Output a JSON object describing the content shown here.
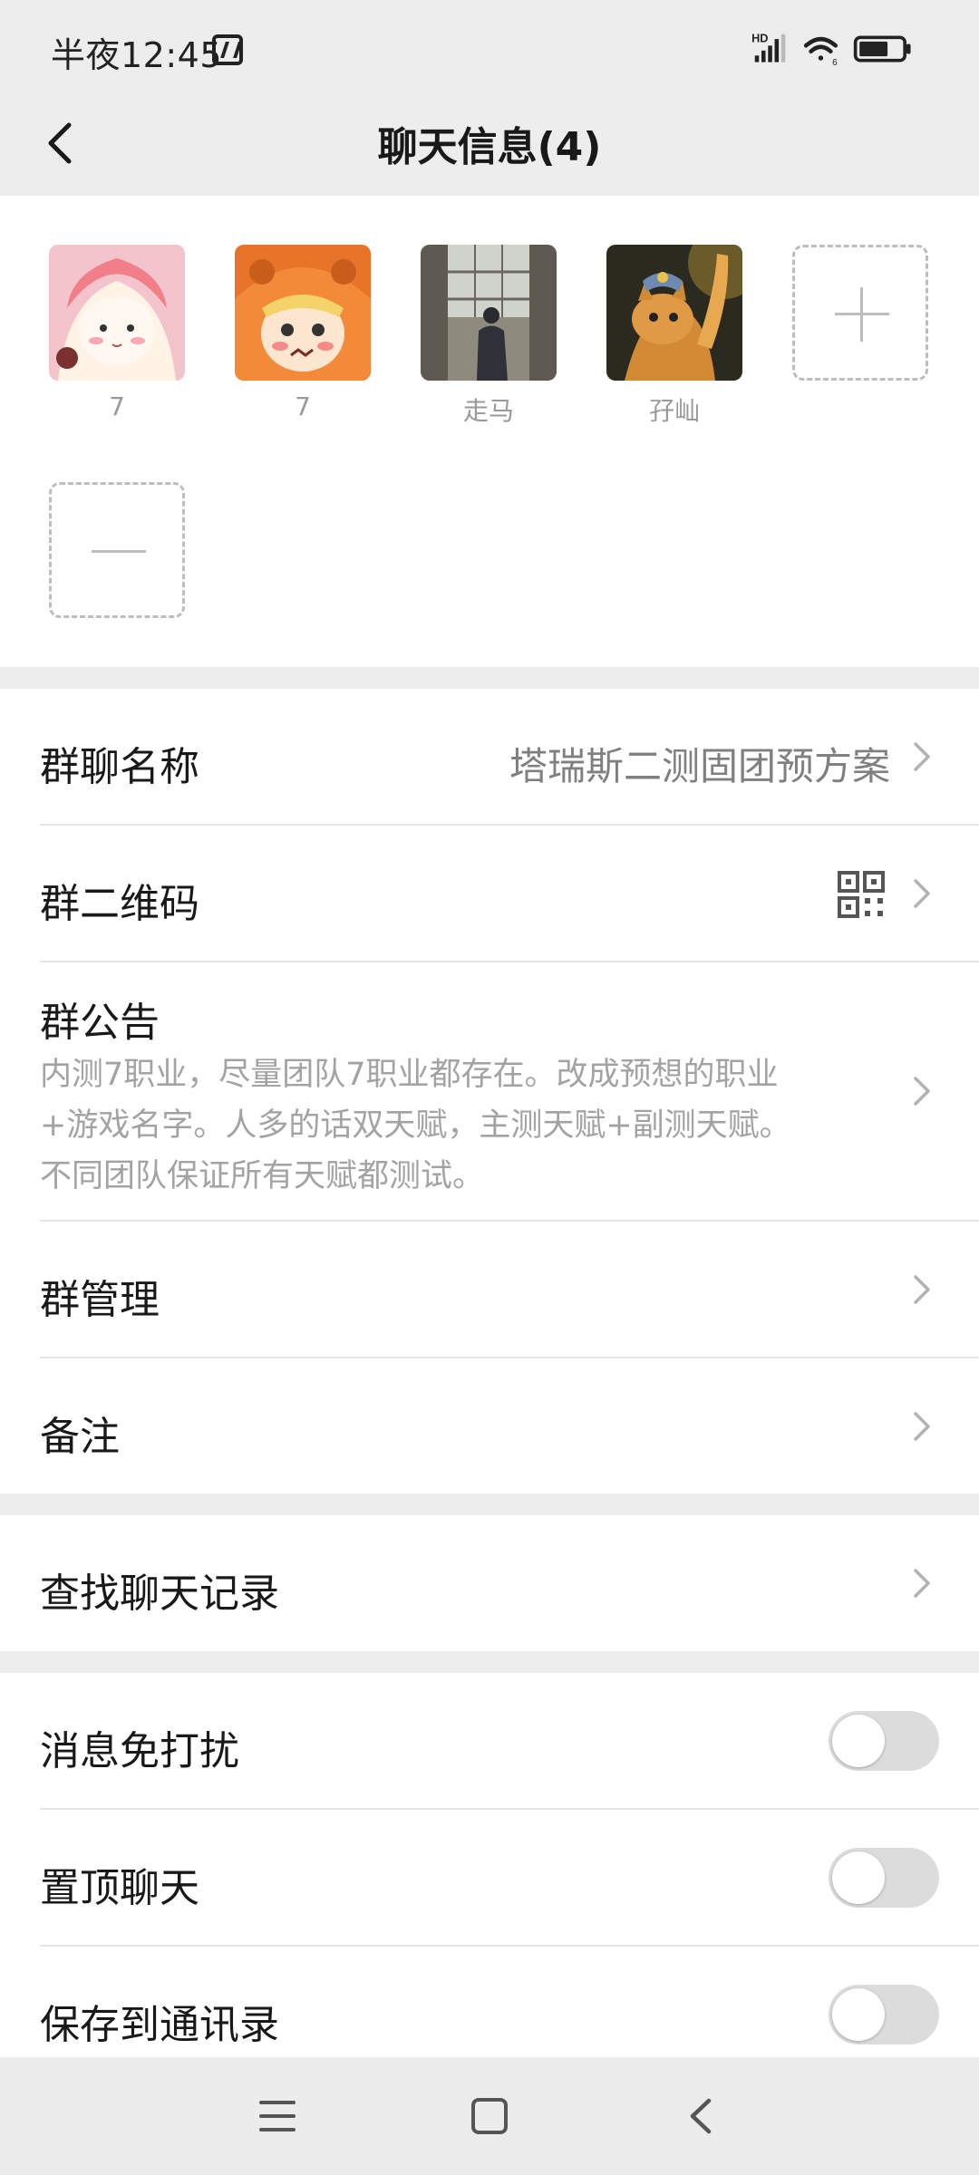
{
  "status_bar": {
    "time": "半夜12:45",
    "network_label": "HD",
    "network_sub": "6"
  },
  "header": {
    "title": "聊天信息(4)"
  },
  "members": [
    {
      "name": "7",
      "avatar": "anime-girl-pink-hat"
    },
    {
      "name": "7",
      "avatar": "anime-girl-orange-hood"
    },
    {
      "name": "走马",
      "avatar": "man-walking-photo"
    },
    {
      "name": "孖屾",
      "avatar": "orange-cat-photo"
    }
  ],
  "settings": {
    "group_name_label": "群聊名称",
    "group_name_value": "塔瑞斯二测固团预方案",
    "qr_label": "群二维码",
    "notice_label": "群公告",
    "notice_lines": [
      "内测7职业，尽量团队7职业都存在。改成预想的职业",
      "+游戏名字。人多的话双天赋，主测天赋+副测天赋。",
      "不同团队保证所有天赋都测试。"
    ],
    "manage_label": "群管理",
    "remark_label": "备注",
    "search_label": "查找聊天记录",
    "mute_label": "消息免打扰",
    "pin_label": "置顶聊天",
    "save_label": "保存到通讯录",
    "mute_on": false,
    "pin_on": false,
    "save_on": false
  },
  "colors": {
    "background": "#ededed",
    "card": "#ffffff",
    "secondary_text": "#808080",
    "toggle_off": "#dcdcdc"
  }
}
